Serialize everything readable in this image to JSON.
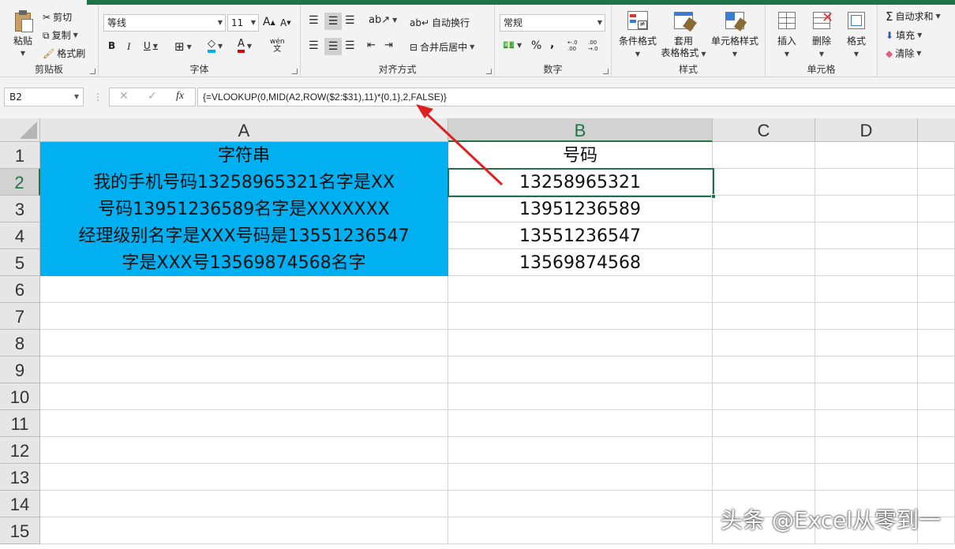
{
  "ribbon": {
    "clipboard": {
      "label": "剪贴板",
      "paste": "粘贴",
      "cut": "剪切",
      "copy": "复制",
      "format_painter": "格式刷"
    },
    "font": {
      "label": "字体",
      "font_name": "等线",
      "font_size": "11",
      "bold": "B",
      "italic": "I",
      "underline": "U",
      "grow": "A",
      "shrink": "A",
      "font_color": "A",
      "phonetic": "wén"
    },
    "alignment": {
      "label": "对齐方式",
      "wrap_text": "自动换行",
      "merge_center": "合并后居中"
    },
    "number": {
      "label": "数字",
      "format": "常规",
      "percent": "%",
      "comma": ",",
      "inc_decimal": "←.0 .00",
      "dec_decimal": ".00 →.0"
    },
    "styles": {
      "label": "样式",
      "conditional": "条件格式",
      "table_format_1": "套用",
      "table_format_2": "表格格式",
      "cell_styles": "单元格样式"
    },
    "cells": {
      "label": "单元格",
      "insert": "插入",
      "delete": "删除",
      "format": "格式"
    },
    "editing": {
      "autosum": "自动求和",
      "fill": "填充",
      "clear": "清除"
    }
  },
  "formula_bar": {
    "name_box": "B2",
    "cancel": "✕",
    "enter": "✓",
    "fx": "fx",
    "formula": "{=VLOOKUP(0,MID(A2,ROW($2:$31),11)*{0,1},2,FALSE)}"
  },
  "sheet": {
    "columns": [
      "A",
      "B",
      "C",
      "D"
    ],
    "rows": [
      "1",
      "2",
      "3",
      "4",
      "5",
      "6",
      "7",
      "8",
      "9",
      "10",
      "11",
      "12",
      "13",
      "14",
      "15"
    ],
    "cells": {
      "A1": "字符串",
      "A2": "我的手机号码13258965321名字是XX",
      "A3": "号码13951236589名字是XXXXXXX",
      "A4": "经理级别名字是XXX号码是13551236547",
      "A5": "字是XXX号13569874568名字",
      "B1": "号码",
      "B2": "13258965321",
      "B3": "13951236589",
      "B4": "13551236547",
      "B5": "13569874568"
    },
    "header_fill_color": "#00b0f0",
    "accent_color": "#217346"
  },
  "watermark": "头条 @Excel从零到一",
  "annotation": {
    "arrow_color": "#e02020"
  }
}
